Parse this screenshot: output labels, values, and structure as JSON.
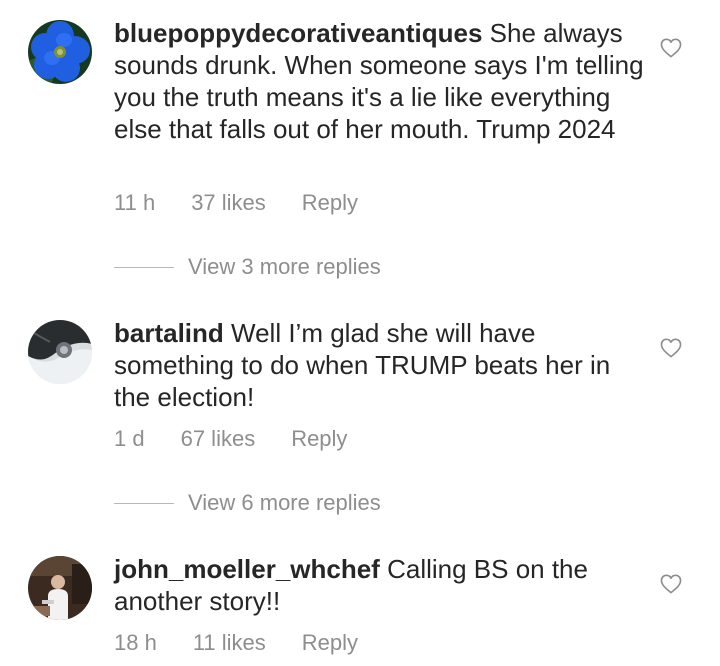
{
  "comments": [
    {
      "username": "bluepoppydecorativeantiques",
      "text": "She always sounds drunk. When someone says I'm telling you the truth means it's a lie like everything else that falls out of her mouth. Trump 2024",
      "time": "11 h",
      "likes": "37 likes",
      "reply_label": "Reply",
      "view_replies": "View 3 more replies",
      "avatar_icon": "blue-flower-avatar"
    },
    {
      "username": "bartalind",
      "text": "Well I’m glad she will have something to do when TRUMP beats her in the election!",
      "time": "1 d",
      "likes": "67 likes",
      "reply_label": "Reply",
      "view_replies": "View 6 more replies",
      "avatar_icon": "car-wheel-avatar"
    },
    {
      "username": "john_moeller_whchef",
      "text": "Calling BS on the another story!!",
      "time": "18 h",
      "likes": "11 likes",
      "reply_label": "Reply",
      "avatar_icon": "chef-kitchen-avatar"
    }
  ],
  "icons": {
    "like": "heart-outline-icon"
  },
  "colors": {
    "text": "#262626",
    "meta": "#8e8e8e",
    "flower": "#1e5fd6"
  }
}
